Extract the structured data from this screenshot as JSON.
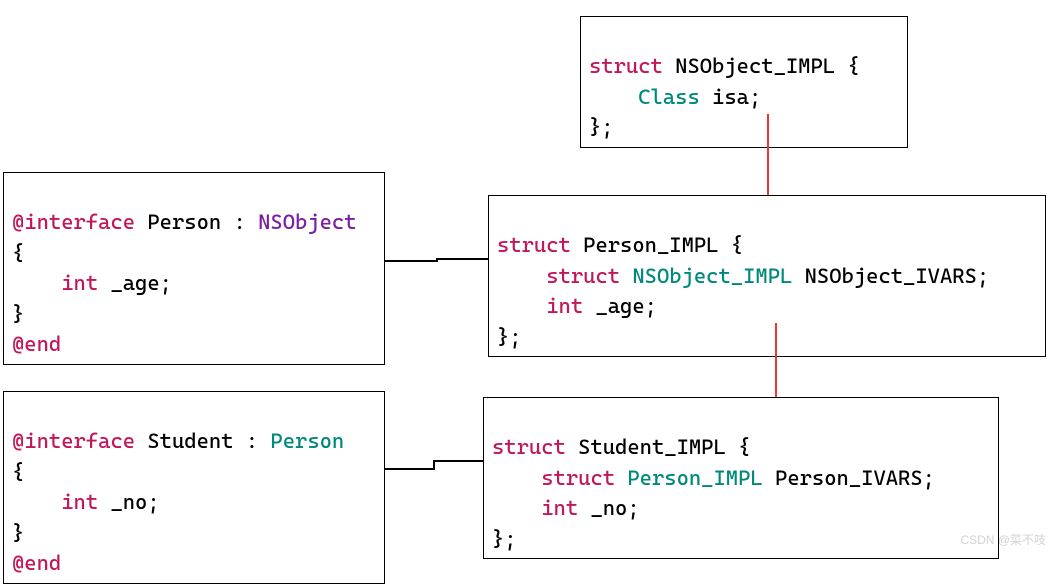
{
  "diagram": {
    "nsobject_impl": {
      "line1_struct": "struct",
      "line1_name": " NSObject_IMPL {",
      "line2_indent": "    ",
      "line2_type": "Class",
      "line2_field": " isa;",
      "line3": "};"
    },
    "person_interface": {
      "line1_at": "@interface",
      "line1_name": " Person : ",
      "line1_super": "NSObject",
      "line2": "{",
      "line3_indent": "    ",
      "line3_type": "int",
      "line3_field": " _age;",
      "line4": "}",
      "line5_at": "@end"
    },
    "person_impl": {
      "line1_struct": "struct",
      "line1_name": " Person_IMPL {",
      "line2_indent": "    ",
      "line2_struct": "struct",
      "line2_type": " NSObject_IMPL",
      "line2_field": " NSObject_IVARS;",
      "line3_indent": "    ",
      "line3_type": "int",
      "line3_field": " _age;",
      "line4": "};"
    },
    "student_interface": {
      "line1_at": "@interface",
      "line1_name": " Student : ",
      "line1_super": "Person",
      "line2": "{",
      "line3_indent": "    ",
      "line3_type": "int",
      "line3_field": " _no;",
      "line4": "}",
      "line5_at": "@end"
    },
    "student_impl": {
      "line1_struct": "struct",
      "line1_name": " Student_IMPL {",
      "line2_indent": "    ",
      "line2_struct": "struct",
      "line2_type": " Person_IMPL",
      "line2_field": " Person_IVARS;",
      "line3_indent": "    ",
      "line3_type": "int",
      "line3_field": " _no;",
      "line4": "};"
    },
    "watermark": "CSDN @菜不吱"
  }
}
